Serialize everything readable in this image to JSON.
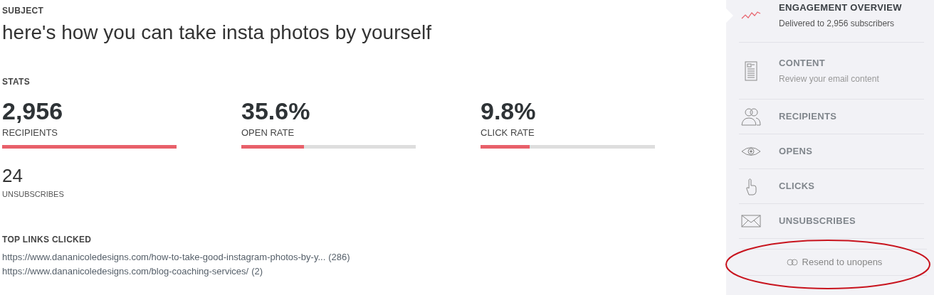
{
  "subject": {
    "label": "SUBJECT",
    "title": "here's how you can take insta photos by yourself"
  },
  "stats": {
    "heading": "STATS",
    "metrics": [
      {
        "value": "2,956",
        "label": "RECIPIENTS",
        "level": 1.0
      },
      {
        "value": "35.6%",
        "label": "OPEN RATE",
        "level": 0.36
      },
      {
        "value": "9.8%",
        "label": "CLICK RATE",
        "level": 0.28
      }
    ],
    "unsubscribes": {
      "value": "24",
      "label": "UNSUBSCRIBES"
    }
  },
  "top_links": {
    "heading": "TOP LINKS CLICKED",
    "links": [
      {
        "url": "https://www.dananicoledesigns.com/how-to-take-good-instagram-photos-by-y...",
        "count": "(286)"
      },
      {
        "url": "https://www.dananicoledesigns.com/blog-coaching-services/",
        "count": "(2)"
      }
    ]
  },
  "sidebar": {
    "items": [
      {
        "title": "ENGAGEMENT OVERVIEW",
        "subtitle": "Delivered to 2,956 subscribers",
        "selected": true
      },
      {
        "title": "CONTENT",
        "subtitle": "Review your email content",
        "selected": false
      },
      {
        "title": "RECIPIENTS",
        "selected": false
      },
      {
        "title": "OPENS",
        "selected": false
      },
      {
        "title": "CLICKS",
        "selected": false
      },
      {
        "title": "UNSUBSCRIBES",
        "selected": false
      }
    ],
    "resend_button": "Resend to unopens"
  }
}
